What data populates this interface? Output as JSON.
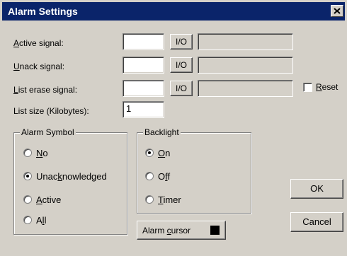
{
  "window": {
    "title": "Alarm Settings"
  },
  "signals": [
    {
      "label_ul": "A",
      "label_rest": "ctive signal:",
      "value": "",
      "io_label": "I/O",
      "address": ""
    },
    {
      "label_ul": "U",
      "label_rest": "nack signal:",
      "value": "",
      "io_label": "I/O",
      "address": ""
    },
    {
      "label_ul": "L",
      "label_rest": "ist erase signal:",
      "value": "",
      "io_label": "I/O",
      "address": ""
    }
  ],
  "reset": {
    "label_ul": "R",
    "label_rest": "eset",
    "checked": false
  },
  "list_size": {
    "label": "List size (Kilobytes):",
    "value": "1"
  },
  "alarm_symbol": {
    "title": "Alarm Symbol",
    "options": [
      {
        "pre": "",
        "ul": "N",
        "post": "o",
        "selected": false
      },
      {
        "pre": "Unac",
        "ul": "k",
        "post": "nowledged",
        "selected": true
      },
      {
        "pre": "",
        "ul": "A",
        "post": "ctive",
        "selected": false
      },
      {
        "pre": "A",
        "ul": "l",
        "post": "l",
        "selected": false
      }
    ]
  },
  "backlight": {
    "title": "Backlight",
    "options": [
      {
        "pre": "",
        "ul": "O",
        "post": "n",
        "selected": true
      },
      {
        "pre": "O",
        "ul": "f",
        "post": "f",
        "selected": false
      },
      {
        "pre": "",
        "ul": "T",
        "post": "imer",
        "selected": false
      }
    ]
  },
  "alarm_cursor": {
    "pre": "Alarm ",
    "ul": "c",
    "post": "ursor",
    "color": "#000000"
  },
  "buttons": {
    "ok": "OK",
    "cancel": "Cancel"
  },
  "icons": {
    "close": "close-icon"
  }
}
